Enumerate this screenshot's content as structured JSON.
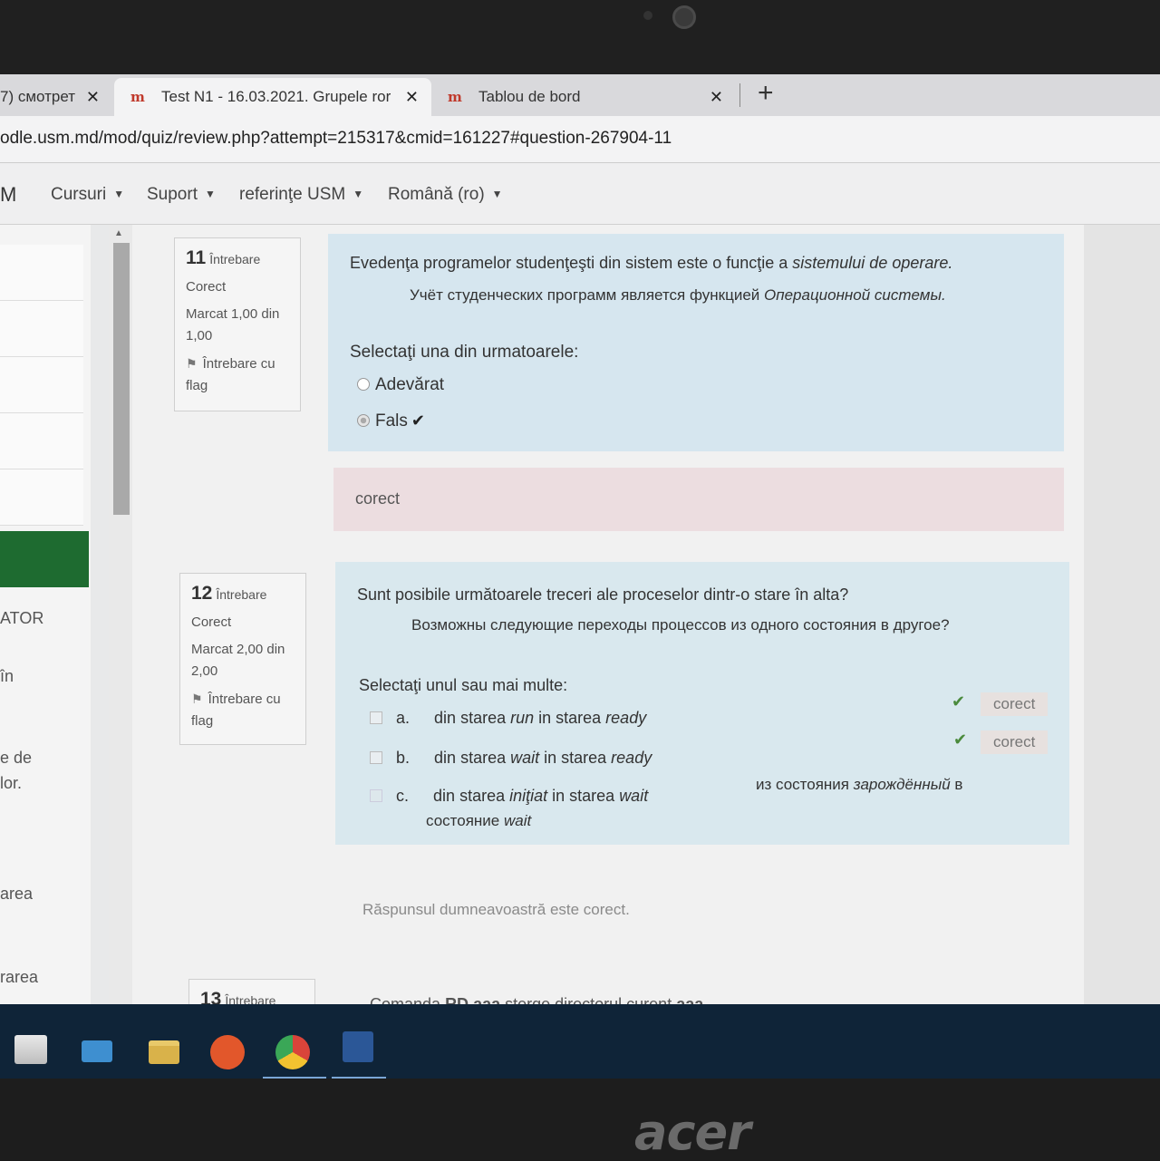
{
  "browser": {
    "tabs": [
      {
        "label": "7) смотрет",
        "favicon": "",
        "active": false
      },
      {
        "label": "Test N1 - 16.03.2021. Grupele ror",
        "favicon": "moodle-icon",
        "active": true
      },
      {
        "label": "Tablou de bord",
        "favicon": "moodle-icon",
        "active": false
      }
    ],
    "close_glyph": "✕",
    "new_tab_glyph": "+",
    "url": "odle.usm.md/mod/quiz/review.php?attempt=215317&cmid=161227#question-267904-11"
  },
  "nav": {
    "logo": "M",
    "items": [
      "Cursuri",
      "Suport",
      "referinţe USM",
      "Română (ro)"
    ]
  },
  "sidebar": {
    "fragments": [
      "ATOR",
      "în",
      "e de",
      "lor.",
      "area",
      "rarea"
    ]
  },
  "questions": [
    {
      "number": "11",
      "word": "Întrebare",
      "status": "Corect",
      "mark": "Marcat 1,00 din 1,00",
      "flag_label": "Întrebare cu flag",
      "text_ro_before": "Evedenţa programelor studenţeşti din sistem este o funcţie a ",
      "text_ro_italic": "sistemului de operare.",
      "text_ru_before": "Учёт студенческих программ является функцией ",
      "text_ru_italic": "Операционной системы.",
      "prompt": "Selectaţi una din urmatoarele:",
      "options": [
        {
          "label": "Adevărat",
          "checked": false
        },
        {
          "label": "Fals",
          "checked": true,
          "mark": "✔"
        }
      ],
      "feedback": "corect"
    },
    {
      "number": "12",
      "word": "Întrebare",
      "status": "Corect",
      "mark": "Marcat 2,00 din 2,00",
      "flag_label": "Întrebare cu flag",
      "text_ro": "Sunt posibile următoarele treceri ale proceselor dintr-o stare în alta?",
      "text_ru": "Возможны следующие переходы процессов из одного состояния в другое?",
      "prompt": "Selectaţi unul sau mai multe:",
      "options": [
        {
          "letter": "a.",
          "pre": "din starea ",
          "s1": "run",
          "mid": " in starea ",
          "s2": "ready",
          "checked": true,
          "feedback": "corect",
          "mark": "✔"
        },
        {
          "letter": "b.",
          "pre": "din starea ",
          "s1": "wait",
          "mid": " in starea ",
          "s2": "ready",
          "checked": true,
          "feedback": "corect",
          "mark": "✔"
        },
        {
          "letter": "c.",
          "pre": "din starea ",
          "s1": "iniţiat",
          "mid": " in starea ",
          "s2": "wait",
          "checked": false,
          "ru_pre": "из состояния ",
          "ru_italic": "зарождённый",
          "ru_post": " в",
          "ru_line2": "состояние ",
          "ru_line2_italic": "wait"
        }
      ],
      "outcome": "Răspunsul dumneavoastră este corect."
    },
    {
      "number": "13",
      "word": "Întrebare",
      "text_parts": [
        "Comanda ",
        "RD",
        " aaa",
        " şterge directorul curent ",
        "aaa"
      ]
    }
  ],
  "taskbar": {
    "icons": [
      "store-icon",
      "mail-icon",
      "file-explorer-icon",
      "ubuntu-icon",
      "chrome-icon",
      "word-icon"
    ]
  },
  "laptop_brand": "acer",
  "colors": {
    "question_bg": "#d6e6ef",
    "feedback_bg": "#ecdde0",
    "correct_check": "#4a8a3c",
    "taskbar": "#0f2438",
    "sidebar_green": "#1e6b30"
  }
}
